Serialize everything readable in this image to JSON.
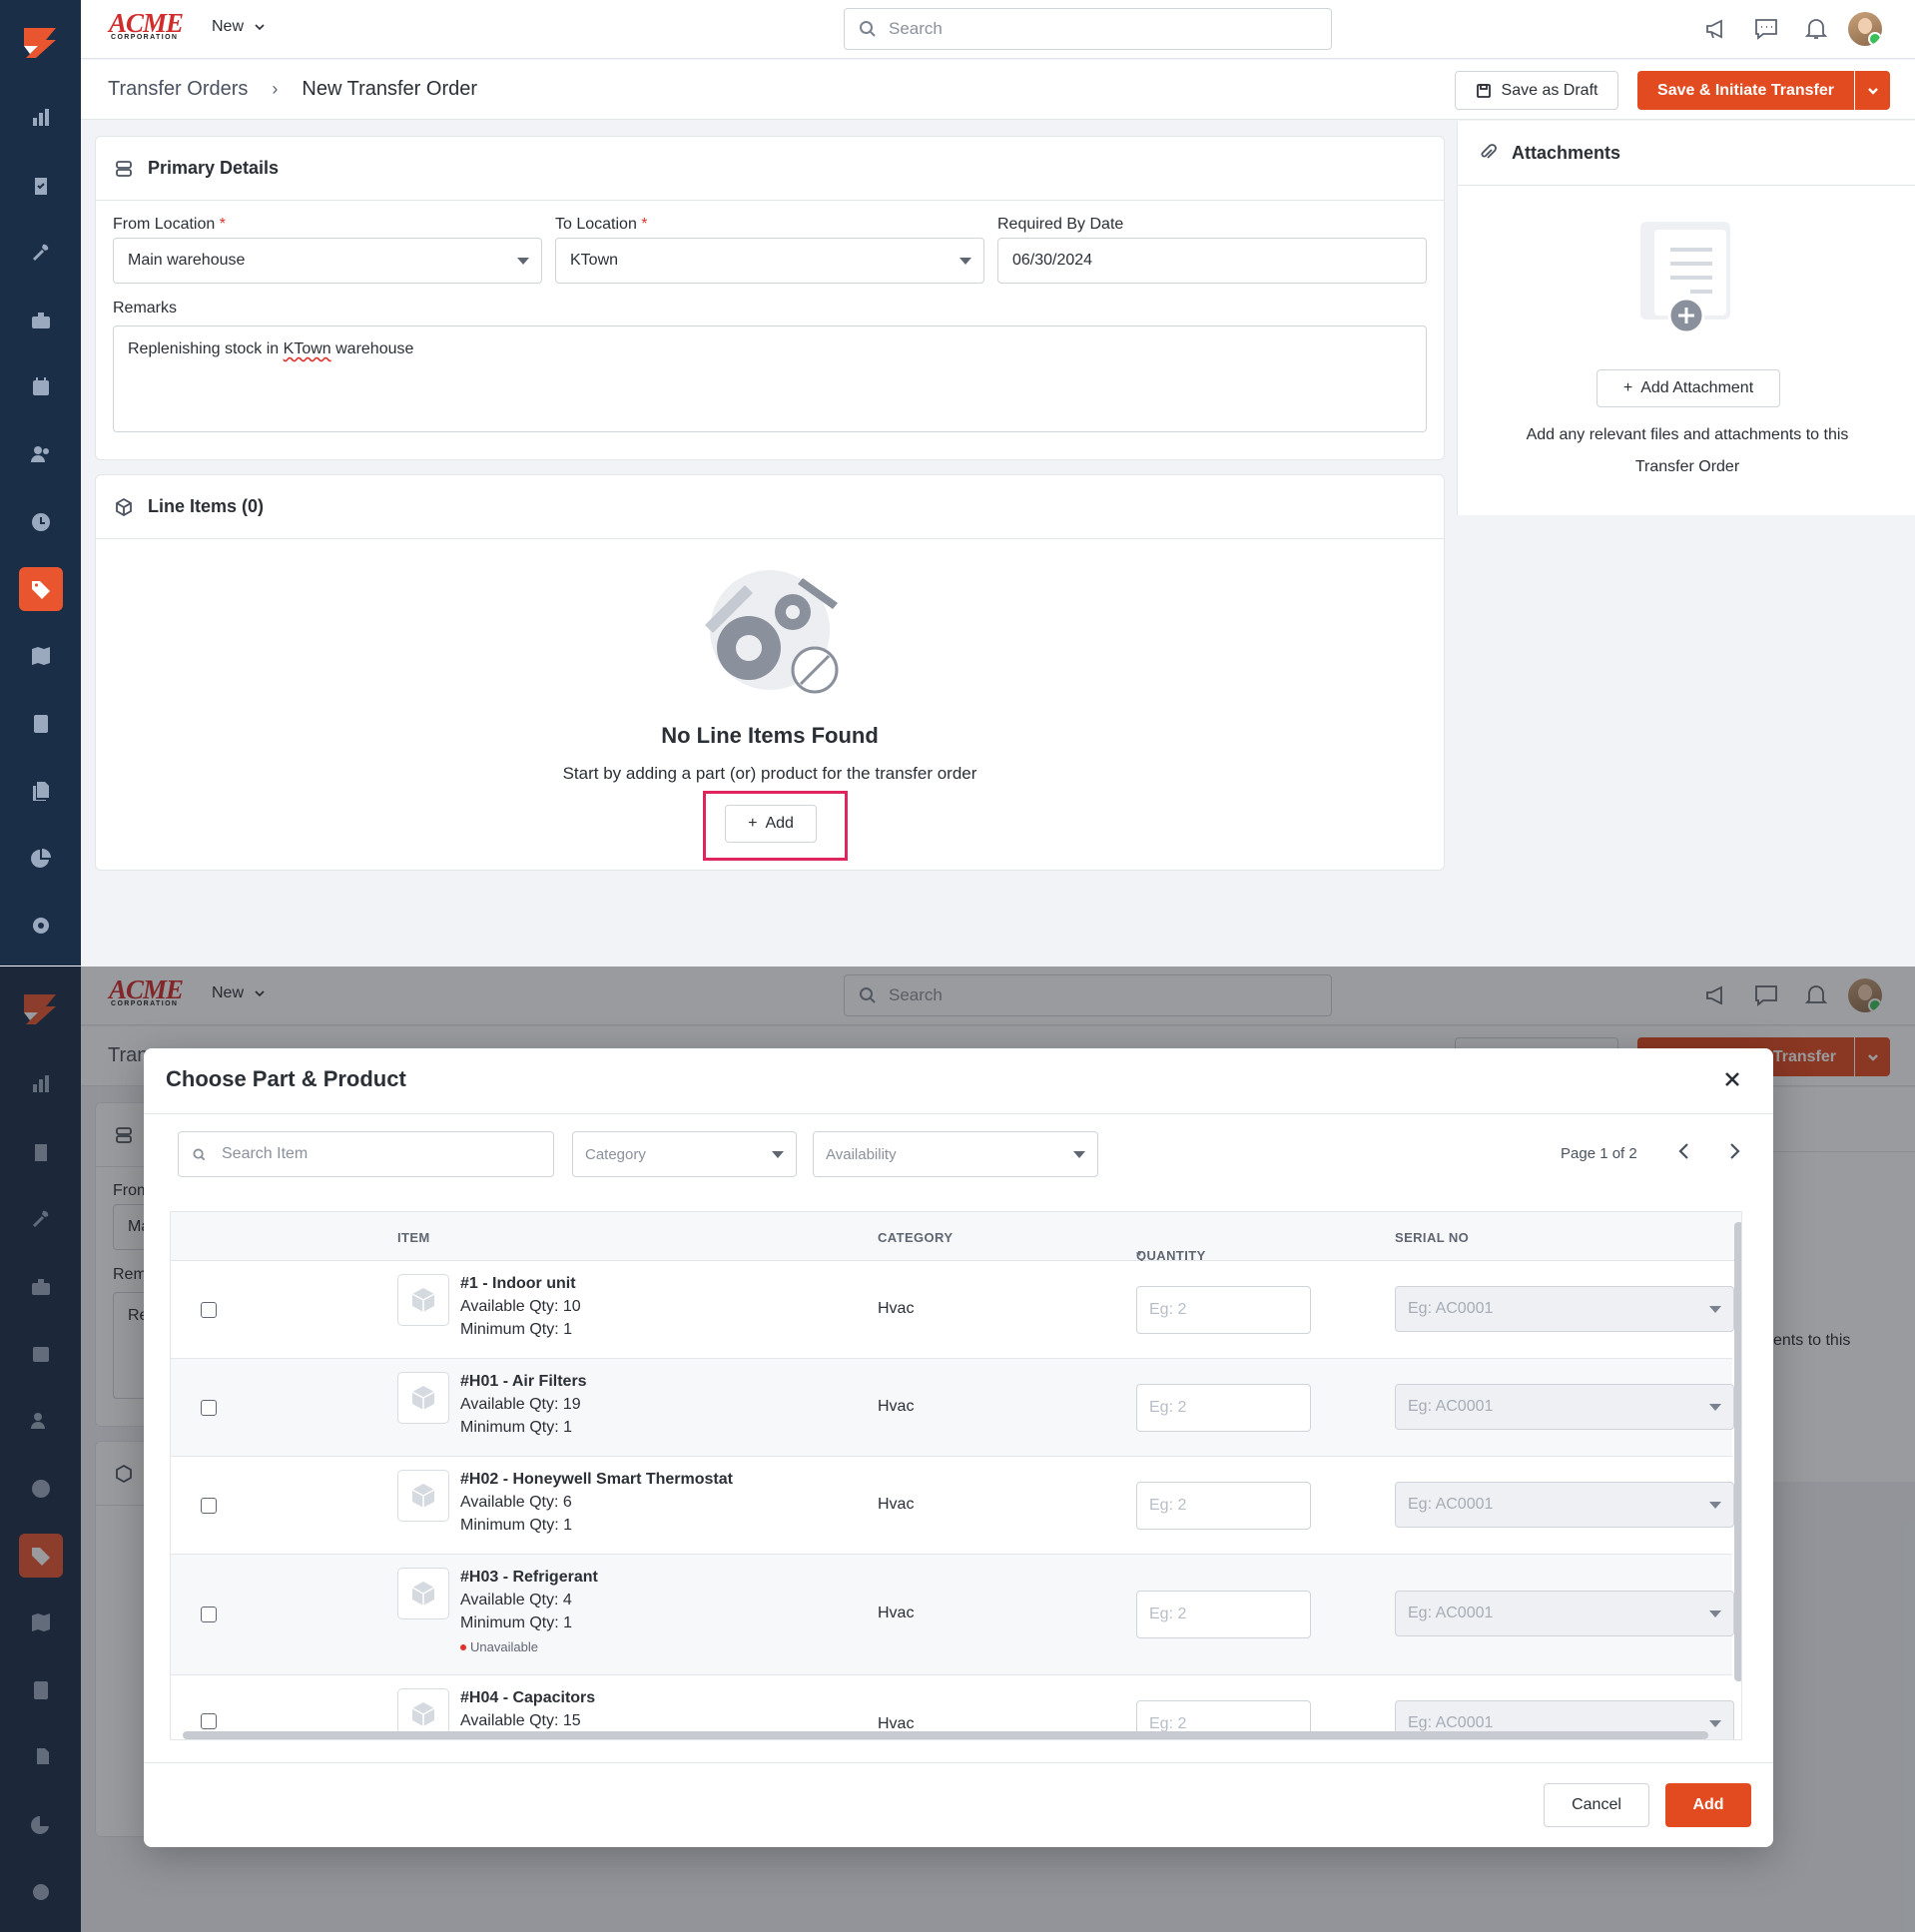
{
  "app": {
    "brand_name": "ACME",
    "brand_sub": "CORPORATION",
    "new_label": "New",
    "search_placeholder": "Search",
    "accent_color": "#e24a20",
    "sidebar_color": "#1a2e47"
  },
  "sidebar": {
    "items": [
      "dashboard-icon",
      "checklist-icon",
      "tools-icon",
      "briefcase-icon",
      "calendar-icon",
      "users-icon",
      "clock-icon",
      "tag-icon",
      "map-icon",
      "calculator-icon",
      "documents-icon",
      "pie-chart-icon",
      "settings-icon"
    ],
    "active": "tag-icon"
  },
  "header": {
    "breadcrumb_root": "Transfer Orders",
    "breadcrumb_current": "New Transfer Order",
    "save_draft_label": "Save as Draft",
    "save_initiate_label": "Save & Initiate Transfer"
  },
  "primary_details": {
    "title": "Primary Details",
    "from_location_label": "From Location",
    "from_location_value": "Main warehouse",
    "to_location_label": "To Location",
    "to_location_value": "KTown",
    "required_by_label": "Required By Date",
    "required_by_value": "06/30/2024",
    "remarks_label": "Remarks",
    "remarks_value_prefix": "Replenishing stock in ",
    "remarks_value_misspelled": "KTown",
    "remarks_value_suffix": " warehouse",
    "required_mark": "*"
  },
  "line_items": {
    "title": "Line Items (0)",
    "empty_title": "No Line Items Found",
    "empty_subtitle": "Start by adding a part (or) product for the transfer order",
    "add_label": "Add"
  },
  "attachments": {
    "title": "Attachments",
    "add_label": "Add Attachment",
    "description": "Add any relevant files and attachments to this Transfer Order"
  },
  "modal": {
    "title": "Choose Part & Product",
    "search_placeholder": "Search Item",
    "category_placeholder": "Category",
    "availability_placeholder": "Availability",
    "page_info": "Page 1 of 2",
    "columns": {
      "item": "ITEM",
      "category": "CATEGORY",
      "quantity": "QUANTITY",
      "serial": "SERIAL NO"
    },
    "quantity_placeholder": "Eg: 2",
    "serial_placeholder": "Eg: AC0001",
    "cancel_label": "Cancel",
    "add_label": "Add",
    "rows": [
      {
        "name": "#1 - Indoor unit",
        "available": "Available Qty: 10",
        "minimum": "Minimum Qty: 1",
        "category": "Hvac",
        "status": ""
      },
      {
        "name": "#H01 - Air Filters",
        "available": "Available Qty: 19",
        "minimum": "Minimum Qty: 1",
        "category": "Hvac",
        "status": ""
      },
      {
        "name": "#H02 - Honeywell Smart Thermostat",
        "available": "Available Qty: 6",
        "minimum": "Minimum Qty: 1",
        "category": "Hvac",
        "status": ""
      },
      {
        "name": "#H03 - Refrigerant",
        "available": "Available Qty: 4",
        "minimum": "Minimum Qty: 1",
        "category": "Hvac",
        "status": "Unavailable"
      },
      {
        "name": "#H04 - Capacitors",
        "available": "Available Qty: 15",
        "minimum": "",
        "category": "Hvac",
        "status": ""
      }
    ]
  },
  "background_peek": {
    "breadcrumb_frag": "Tran",
    "from_frag": "From",
    "from_value_frag": "Ma",
    "remarks_frag": "Rem",
    "remarks_value_frag": "Re",
    "attach_desc_frag": "ents to this",
    "initiate_frag": "Transfer"
  }
}
